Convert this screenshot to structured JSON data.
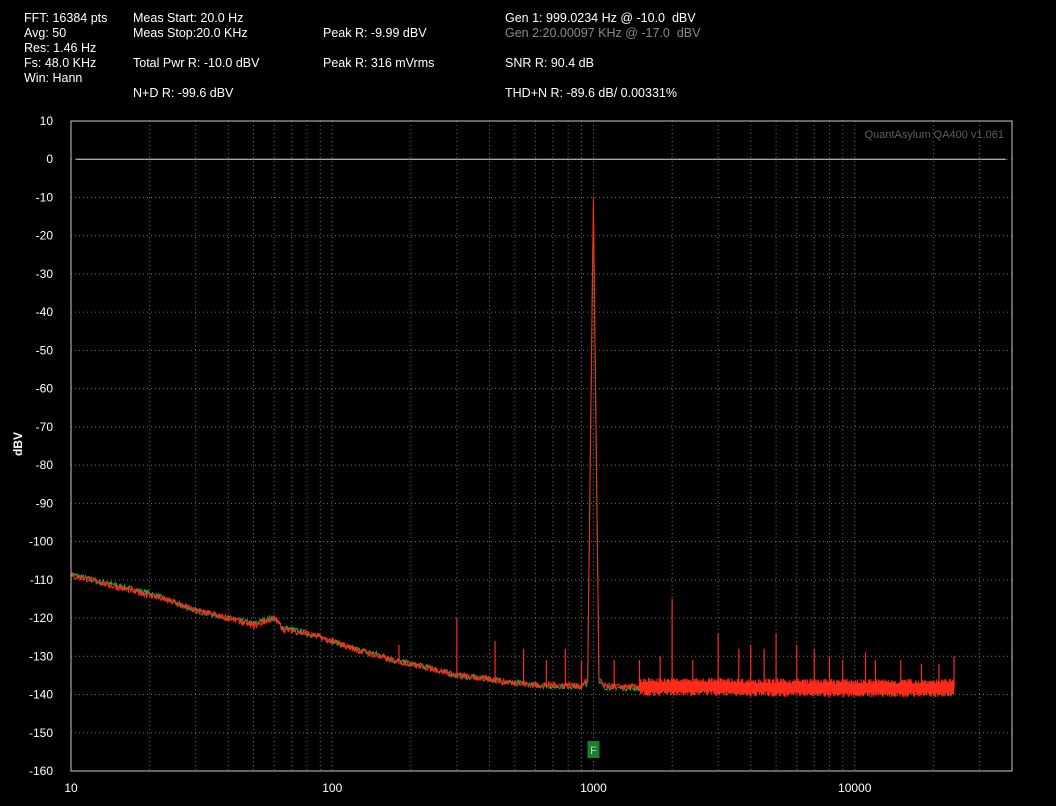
{
  "header": {
    "col1": [
      "FFT: 16384 pts",
      "Avg: 50",
      "Res: 1.46 Hz",
      "Fs: 48.0 KHz",
      "Win: Hann"
    ],
    "meas_start": "Meas Start: 20.0 Hz",
    "meas_stop": "Meas Stop:20.0 KHz",
    "total_pwr": "Total Pwr R: -10.0 dBV",
    "nd": "N+D R: -99.6 dBV",
    "peak_dbv": "Peak R: -9.99 dBV",
    "peak_mvrms": "Peak R: 316 mVrms",
    "gen1": "Gen 1: 999.0234 Hz @ -10.0  dBV",
    "gen2": "Gen 2:20.00097 KHz @ -17.0  dBV",
    "snr": "SNR R: 90.4 dB",
    "thdn": "THD+N R: -89.6 dB/ 0.00331%"
  },
  "watermark": "QuantAsylum QA400 v1.061",
  "marker_label": "F",
  "colors": {
    "background": "#000000",
    "frame": "#c8c8c8",
    "grid": "#6e6e6e",
    "reference_line": "#d8d8d8",
    "series_red": "#ff2a1a",
    "series_green": "#2e9e3a",
    "marker": "#1e7d2c"
  },
  "chart_data": {
    "type": "line",
    "title": "",
    "xlabel": "",
    "ylabel": "dBV",
    "x_scale": "log",
    "xlim": [
      10,
      40000
    ],
    "ylim": [
      -160,
      10
    ],
    "x_ticks": [
      10,
      100,
      1000,
      10000
    ],
    "y_ticks": [
      10,
      0,
      -10,
      -20,
      -30,
      -40,
      -50,
      -60,
      -70,
      -80,
      -90,
      -100,
      -110,
      -120,
      -130,
      -140,
      -150,
      -160
    ],
    "grid": true,
    "reference_line_y": 0,
    "marker_x": 1000,
    "series": [
      {
        "color": "red",
        "x": [
          10,
          12,
          15,
          20,
          25,
          30,
          40,
          50,
          55,
          60,
          65,
          80,
          100,
          120,
          150,
          170,
          200,
          250,
          300,
          400,
          500,
          600,
          700,
          800,
          900,
          950,
          999,
          1050,
          1100,
          1300,
          1500,
          2000,
          3000,
          4000,
          5000,
          7000,
          10000,
          15000,
          20000,
          24000
        ],
        "y": [
          -109,
          -110,
          -112,
          -114,
          -116,
          -118,
          -120,
          -122,
          -121,
          -120,
          -123,
          -124,
          -126,
          -128,
          -130,
          -131,
          -132,
          -133.5,
          -135,
          -136,
          -137,
          -137.5,
          -137.5,
          -137.5,
          -137.8,
          -136,
          -10,
          -136,
          -137.8,
          -138,
          -138,
          -138,
          -138,
          -138.2,
          -138.2,
          -138.2,
          -138.3,
          -138.3,
          -138.3,
          -138.3
        ]
      },
      {
        "color": "green",
        "x": [
          10,
          12,
          15,
          20,
          25,
          30,
          40,
          50,
          55,
          60,
          65,
          80,
          100,
          120,
          150,
          170,
          200,
          250,
          300,
          400,
          500,
          600,
          700,
          800,
          900,
          950,
          999,
          1050,
          1100,
          1300,
          1500,
          2000,
          3000,
          4000,
          5000,
          7000,
          10000,
          15000,
          20000,
          24000
        ],
        "y": [
          -108.5,
          -110,
          -111.5,
          -113.5,
          -116,
          -118,
          -120,
          -121.5,
          -120.5,
          -120,
          -122.5,
          -124,
          -126,
          -128,
          -129.5,
          -131,
          -132,
          -133.5,
          -135,
          -136,
          -137,
          -137.5,
          -137.8,
          -137.8,
          -138,
          -137,
          -12,
          -137,
          -138,
          -138.2,
          -138.4,
          -138.5,
          -138.6,
          -138.7,
          -138.8,
          -138.8,
          -138.9,
          -139,
          -139,
          -139
        ]
      }
    ],
    "spurs_red": [
      {
        "x": 60,
        "y": -120
      },
      {
        "x": 180,
        "y": -127
      },
      {
        "x": 300,
        "y": -120
      },
      {
        "x": 420,
        "y": -126
      },
      {
        "x": 540,
        "y": -128
      },
      {
        "x": 660,
        "y": -131
      },
      {
        "x": 780,
        "y": -128
      },
      {
        "x": 900,
        "y": -131
      },
      {
        "x": 1200,
        "y": -131
      },
      {
        "x": 1500,
        "y": -131
      },
      {
        "x": 1800,
        "y": -130
      },
      {
        "x": 2000,
        "y": -115
      },
      {
        "x": 2400,
        "y": -131
      },
      {
        "x": 3000,
        "y": -124
      },
      {
        "x": 3600,
        "y": -128
      },
      {
        "x": 4000,
        "y": -127
      },
      {
        "x": 4500,
        "y": -128
      },
      {
        "x": 5000,
        "y": -124
      },
      {
        "x": 6000,
        "y": -127
      },
      {
        "x": 7000,
        "y": -128
      },
      {
        "x": 8000,
        "y": -130
      },
      {
        "x": 9000,
        "y": -131
      },
      {
        "x": 11000,
        "y": -129
      },
      {
        "x": 12000,
        "y": -131
      },
      {
        "x": 15000,
        "y": -131
      },
      {
        "x": 18000,
        "y": -132
      },
      {
        "x": 21000,
        "y": -132
      },
      {
        "x": 24000,
        "y": -130
      }
    ]
  }
}
